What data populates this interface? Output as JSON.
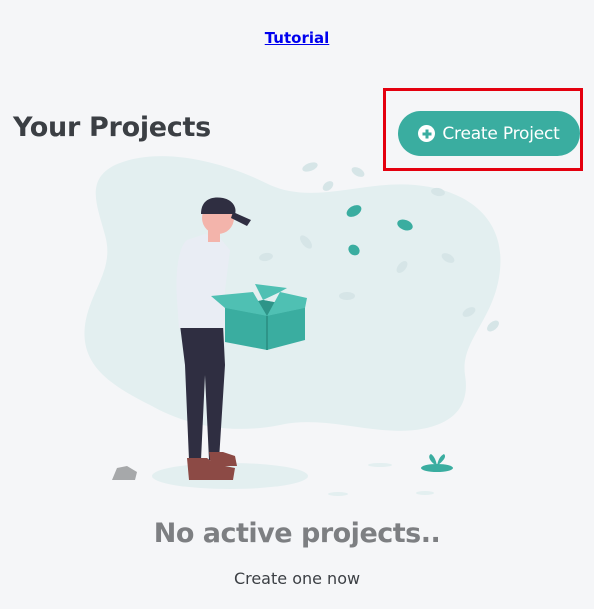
{
  "header": {
    "tutorial_link": "Tutorial"
  },
  "projects": {
    "title": "Your Projects",
    "create_button_label": "Create Project"
  },
  "empty_state": {
    "title": "No active projects..",
    "subtitle": "Create one now",
    "illustration": "person-holding-box-illustration"
  },
  "colors": {
    "accent": "#3aada0",
    "highlight": "#e4000f",
    "blob": "#e3eff0",
    "title_text": "#3b3f44",
    "muted_text": "#7d7f82"
  }
}
